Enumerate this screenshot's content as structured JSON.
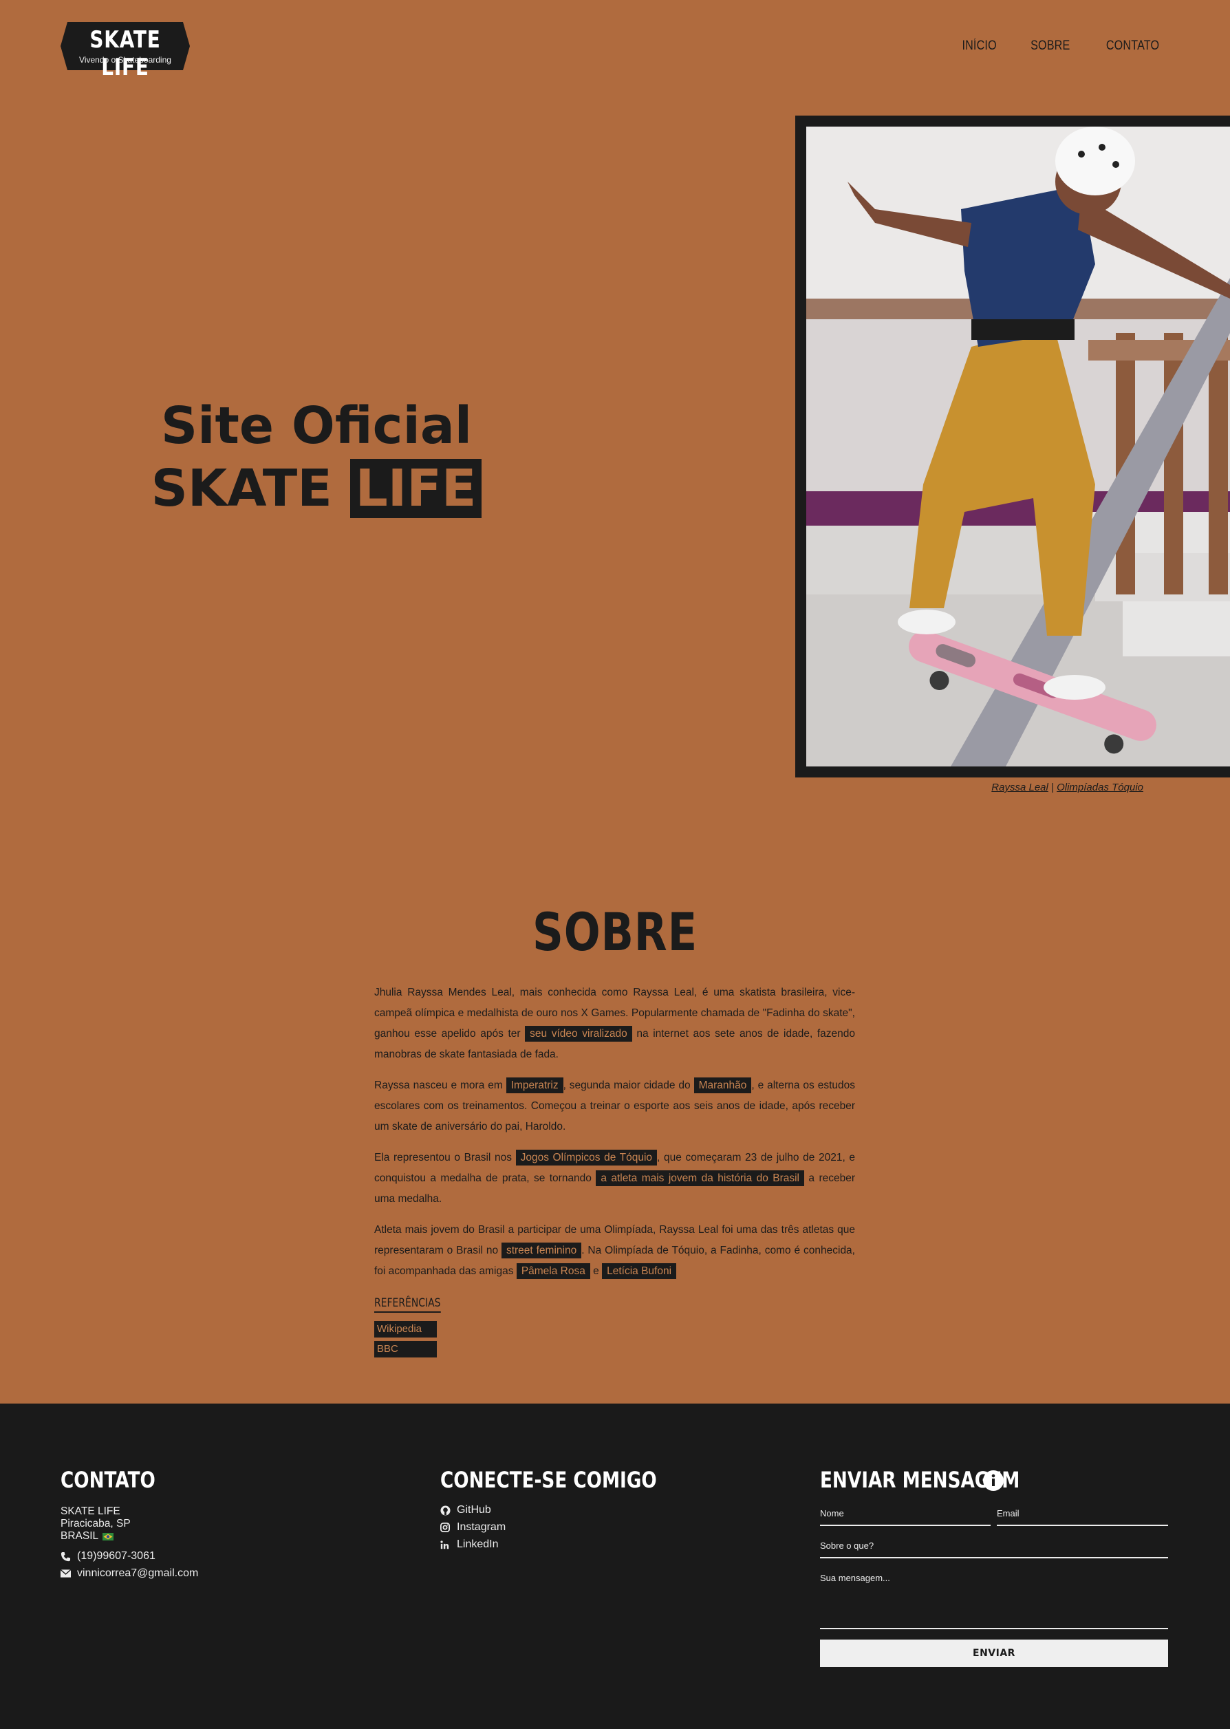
{
  "header": {
    "logo_title": "SKATE LIFE",
    "logo_subtitle": "Vivendo o Skateboarding",
    "nav": [
      "INÍCIO",
      "SOBRE",
      "CONTATO"
    ]
  },
  "hero": {
    "line1": "Site Oficial",
    "line2_plain": "SKATE",
    "line2_highlight": "LIFE",
    "caption_name": "Rayssa Leal",
    "caption_sep": "|",
    "caption_event": "Olimpíadas Tóquio"
  },
  "sobre": {
    "title": "SOBRE",
    "p1a": "Jhulia Rayssa Mendes Leal, mais conhecida como Rayssa Leal, é uma skatista brasileira, vice-campeã olímpica e medalhista de ouro nos X Games. Popularmente chamada de \"Fadinha do skate\", ganhou esse apelido após ter ",
    "p1_link": "seu vídeo viralizado",
    "p1b": " na internet aos sete anos de idade, fazendo manobras de skate fantasiada de fada.",
    "p2a": "Rayssa nasceu e mora em ",
    "p2_link1": "Imperatriz",
    "p2b": ", segunda maior cidade do ",
    "p2_link2": "Maranhão",
    "p2c": ", e alterna os estudos escolares com os treinamentos. Começou a treinar o esporte aos seis anos de idade, após receber um skate de aniversário do pai, Haroldo.",
    "p3a": "Ela representou o Brasil nos ",
    "p3_link1": "Jogos Olímpicos de Tóquio",
    "p3b": ", que começaram 23 de julho de 2021, e conquistou a medalha de prata, se tornando ",
    "p3_link2": "a atleta mais jovem da história do Brasil",
    "p3c": " a receber uma medalha.",
    "p4a": "Atleta mais jovem do Brasil a participar de uma Olimpíada, Rayssa Leal foi uma das três atletas que representaram o Brasil no ",
    "p4_link1": "street feminino",
    "p4b": ". Na Olimpíada de Tóquio, a Fadinha, como é conhecida, foi acompanhada das amigas ",
    "p4_link2": "Pâmela Rosa",
    "p4c": " e ",
    "p4_link3": "Letícia Bufoni",
    "refs_title": "REFERÊNCIAS",
    "refs": [
      "Wikipedia",
      "BBC"
    ]
  },
  "footer": {
    "contato_title": "CONTATO",
    "address": [
      "SKATE LIFE",
      "Piracicaba, SP",
      "BRASIL"
    ],
    "phone": "(19)99607-3061",
    "email": "vinnicorrea7@gmail.com",
    "connect_title": "CONECTE-SE COMIGO",
    "social": [
      "GitHub",
      "Instagram",
      "LinkedIn"
    ],
    "message_title": "ENVIAR MENSAGEM",
    "form": {
      "name_placeholder": "Nome",
      "email_placeholder": "Email",
      "subject_placeholder": "Sobre o que?",
      "message_placeholder": "Sua mensagem...",
      "submit": "ENVIAR"
    }
  },
  "colors": {
    "background": "#b06b3e",
    "dark": "#1b1b1b",
    "accent_text": "#c98552",
    "footer_bg": "#1a1a1a"
  }
}
